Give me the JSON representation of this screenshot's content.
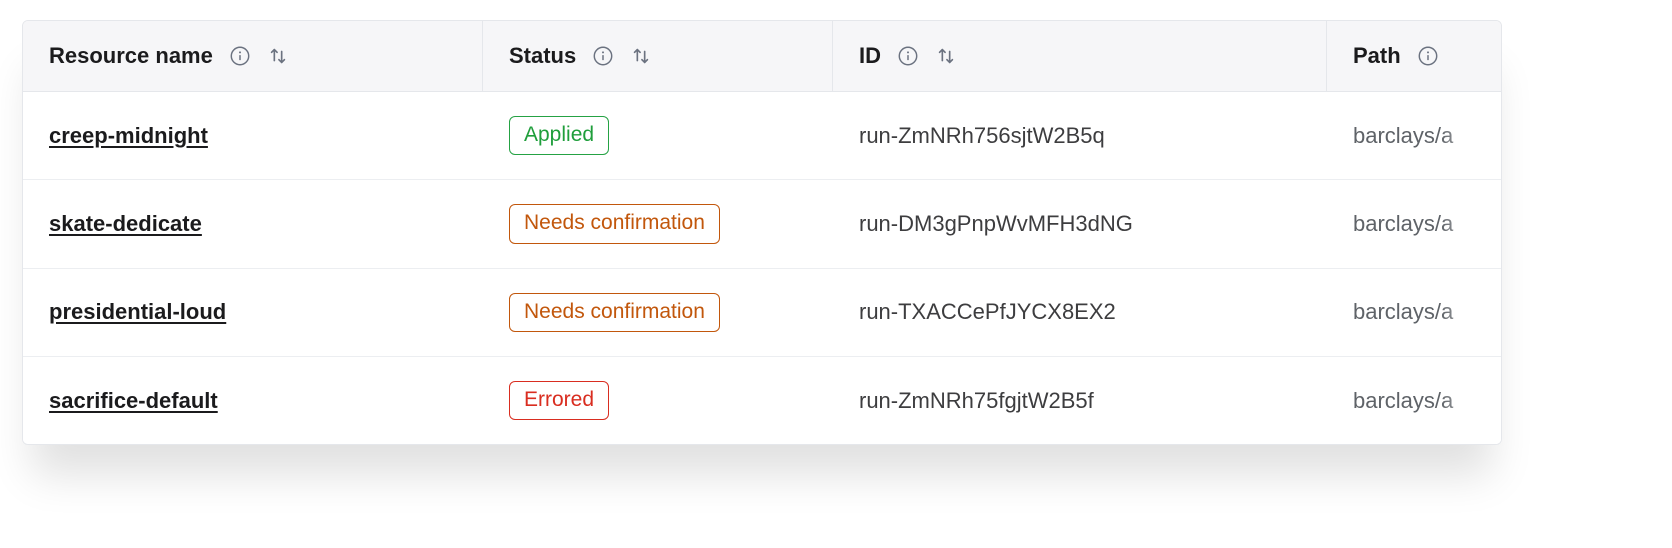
{
  "columns": {
    "name": "Resource name",
    "status": "Status",
    "id": "ID",
    "path": "Path"
  },
  "status_labels": {
    "applied": "Applied",
    "needs": "Needs confirmation",
    "errored": "Errored"
  },
  "rows": [
    {
      "name": "creep-midnight",
      "status": "applied",
      "id": "run-ZmNRh756sjtW2B5q",
      "path": "barclays/a"
    },
    {
      "name": "skate-dedicate",
      "status": "needs",
      "id": "run-DM3gPnpWvMFH3dNG",
      "path": "barclays/a"
    },
    {
      "name": "presidential-loud",
      "status": "needs",
      "id": "run-TXACCePfJYCX8EX2",
      "path": "barclays/a"
    },
    {
      "name": "sacrifice-default",
      "status": "errored",
      "id": "run-ZmNRh75fgjtW2B5f",
      "path": "barclays/a"
    }
  ]
}
